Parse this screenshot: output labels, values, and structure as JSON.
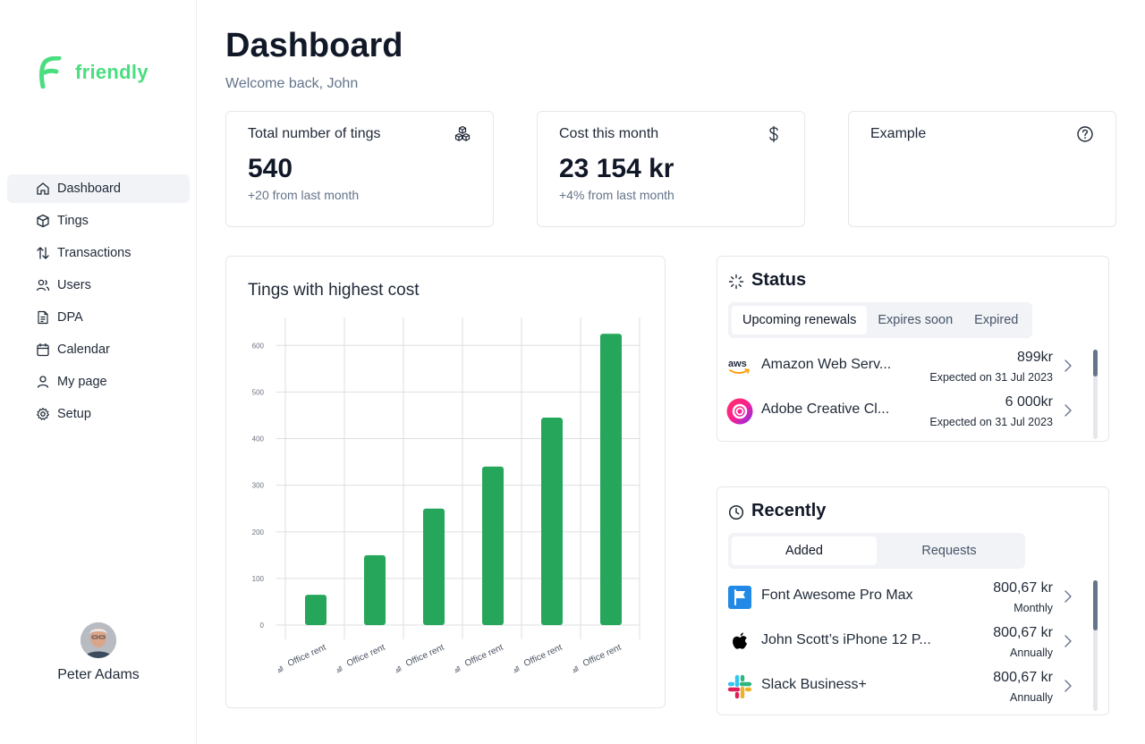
{
  "brand": {
    "name": "friendly",
    "color": "#4ade80"
  },
  "nav": [
    {
      "label": "Dashboard",
      "icon": "home-icon",
      "active": true
    },
    {
      "label": "Tings",
      "icon": "box-icon"
    },
    {
      "label": "Transactions",
      "icon": "arrows-up-down-icon"
    },
    {
      "label": "Users",
      "icon": "users-icon"
    },
    {
      "label": "DPA",
      "icon": "document-icon"
    },
    {
      "label": "Calendar",
      "icon": "calendar-icon"
    },
    {
      "label": "My page",
      "icon": "user-icon"
    },
    {
      "label": "Setup",
      "icon": "gear-icon"
    }
  ],
  "user": {
    "name": "Peter Adams"
  },
  "header": {
    "title": "Dashboard",
    "subtitle": "Welcome back, John"
  },
  "stats": [
    {
      "title": "Total number of tings",
      "value": "540",
      "delta": "+20 from last month",
      "icon": "cubes-icon"
    },
    {
      "title": "Cost this month",
      "value": "23 154 kr",
      "delta": "+4% from last month",
      "icon": "dollar-icon"
    },
    {
      "title": "Example",
      "value": "",
      "delta": "",
      "icon": "help-circle-icon"
    }
  ],
  "chart_data": {
    "type": "bar",
    "title": "Tings with highest cost",
    "categories": [
      "Office rent",
      "Office rent",
      "Office rent",
      "Office rent",
      "Office rent",
      "Office rent"
    ],
    "values": [
      65,
      150,
      250,
      340,
      445,
      625
    ],
    "ylim": [
      0,
      600
    ],
    "yticks": [
      0,
      100,
      200,
      300,
      400,
      500,
      600
    ],
    "grid": true,
    "color": "#26a65b"
  },
  "status": {
    "title": "Status",
    "tabs": [
      "Upcoming renewals",
      "Expires soon",
      "Expired"
    ],
    "active_tab": 0,
    "items": [
      {
        "name": "Amazon Web Serv...",
        "amount": "899kr",
        "meta": "Expected on 31 Jul 2023",
        "icon": "aws-logo-icon"
      },
      {
        "name": "Adobe Creative Cl...",
        "amount": "6 000kr",
        "meta": "Expected on 31 Jul 2023",
        "icon": "adobe-cc-logo-icon"
      }
    ]
  },
  "recently": {
    "title": "Recently",
    "tabs": [
      "Added",
      "Requests"
    ],
    "active_tab": 0,
    "items": [
      {
        "name": "Font Awesome Pro Max",
        "amount": "800,67 kr",
        "meta": "Monthly",
        "icon": "font-awesome-logo-icon"
      },
      {
        "name": "John Scott’s iPhone 12 P...",
        "amount": "800,67 kr",
        "meta": "Annually",
        "icon": "apple-logo-icon"
      },
      {
        "name": "Slack Business+",
        "amount": "800,67 kr",
        "meta": "Annually",
        "icon": "slack-logo-icon"
      }
    ]
  }
}
